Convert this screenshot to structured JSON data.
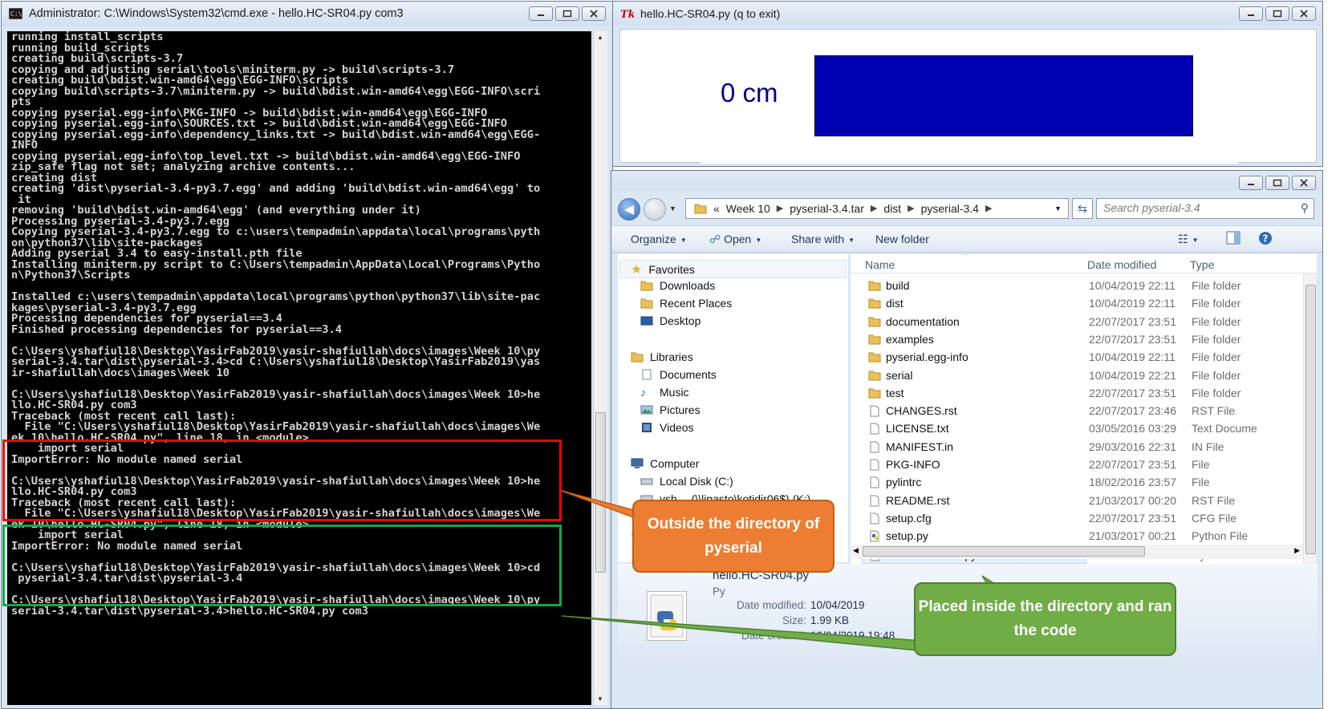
{
  "cmd_window": {
    "title": "Administrator: C:\\Windows\\System32\\cmd.exe - hello.HC-SR04.py  com3",
    "lines": [
      "running install_scripts",
      "running build_scripts",
      "creating build\\scripts-3.7",
      "copying and adjusting serial\\tools\\miniterm.py -> build\\scripts-3.7",
      "creating build\\bdist.win-amd64\\egg\\EGG-INFO\\scripts",
      "copying build\\scripts-3.7\\miniterm.py -> build\\bdist.win-amd64\\egg\\EGG-INFO\\scri",
      "pts",
      "copying pyserial.egg-info\\PKG-INFO -> build\\bdist.win-amd64\\egg\\EGG-INFO",
      "copying pyserial.egg-info\\SOURCES.txt -> build\\bdist.win-amd64\\egg\\EGG-INFO",
      "copying pyserial.egg-info\\dependency_links.txt -> build\\bdist.win-amd64\\egg\\EGG-",
      "INFO",
      "copying pyserial.egg-info\\top_level.txt -> build\\bdist.win-amd64\\egg\\EGG-INFO",
      "zip_safe flag not set; analyzing archive contents...",
      "creating dist",
      "creating 'dist\\pyserial-3.4-py3.7.egg' and adding 'build\\bdist.win-amd64\\egg' to",
      " it",
      "removing 'build\\bdist.win-amd64\\egg' (and everything under it)",
      "Processing pyserial-3.4-py3.7.egg",
      "Copying pyserial-3.4-py3.7.egg to c:\\users\\tempadmin\\appdata\\local\\programs\\pyth",
      "on\\python37\\lib\\site-packages",
      "Adding pyserial 3.4 to easy-install.pth file",
      "Installing miniterm.py script to C:\\Users\\tempadmin\\AppData\\Local\\Programs\\Pytho",
      "n\\Python37\\Scripts",
      "",
      "Installed c:\\users\\tempadmin\\appdata\\local\\programs\\python\\python37\\lib\\site-pac",
      "kages\\pyserial-3.4-py3.7.egg",
      "Processing dependencies for pyserial==3.4",
      "Finished processing dependencies for pyserial==3.4",
      "",
      "C:\\Users\\yshafiul18\\Desktop\\YasirFab2019\\yasir-shafiullah\\docs\\images\\Week 10\\py",
      "serial-3.4.tar\\dist\\pyserial-3.4>cd C:\\Users\\yshafiul18\\Desktop\\YasirFab2019\\yas",
      "ir-shafiullah\\docs\\images\\Week 10",
      "",
      "C:\\Users\\yshafiul18\\Desktop\\YasirFab2019\\yasir-shafiullah\\docs\\images\\Week 10>he",
      "llo.HC-SR04.py com3",
      "Traceback (most recent call last):",
      "  File \"C:\\Users\\yshafiul18\\Desktop\\YasirFab2019\\yasir-shafiullah\\docs\\images\\We",
      "ek 10\\hello.HC-SR04.py\", line 18, in <module>",
      "    import serial",
      "ImportError: No module named serial",
      "",
      "C:\\Users\\yshafiul18\\Desktop\\YasirFab2019\\yasir-shafiullah\\docs\\images\\Week 10>he",
      "llo.HC-SR04.py com3",
      "Traceback (most recent call last):",
      "  File \"C:\\Users\\yshafiul18\\Desktop\\YasirFab2019\\yasir-shafiullah\\docs\\images\\We",
      "ek 10\\hello.HC-SR04.py\", line 18, in <module>",
      "    import serial",
      "ImportError: No module named serial",
      "",
      "C:\\Users\\yshafiul18\\Desktop\\YasirFab2019\\yasir-shafiullah\\docs\\images\\Week 10>cd",
      " pyserial-3.4.tar\\dist\\pyserial-3.4",
      "",
      "C:\\Users\\yshafiul18\\Desktop\\YasirFab2019\\yasir-shafiullah\\docs\\images\\Week 10\\py",
      "serial-3.4.tar\\dist\\pyserial-3.4>hello.HC-SR04.py com3"
    ]
  },
  "tk_window": {
    "title": "hello.HC-SR04.py (q to exit)",
    "distance_label": "0 cm",
    "bar_color": "#0000b3"
  },
  "explorer": {
    "breadcrumb": [
      "«",
      "Week 10",
      "pyserial-3.4.tar",
      "dist",
      "pyserial-3.4"
    ],
    "search_placeholder": "Search pyserial-3.4",
    "toolbar": {
      "organize": "Organize",
      "open": "Open",
      "share_with": "Share with",
      "new_folder": "New folder"
    },
    "nav": {
      "favorites": "Favorites",
      "downloads": "Downloads",
      "recent_places": "Recent Places",
      "desktop": "Desktop",
      "libraries": "Libraries",
      "documents": "Documents",
      "music": "Music",
      "pictures": "Pictures",
      "videos": "Videos",
      "computer": "Computer",
      "local_disk": "Local Disk (C:)",
      "network_drive": "ysh… (\\\\lipasto\\kotidir06$) (K:)",
      "network": "Ne"
    },
    "columns": {
      "name": "Name",
      "date": "Date modified",
      "type": "Type"
    },
    "files": [
      {
        "name": "build",
        "date": "10/04/2019 22:11",
        "type": "File folder",
        "icon": "folder-icon"
      },
      {
        "name": "dist",
        "date": "10/04/2019 22:11",
        "type": "File folder",
        "icon": "folder-icon"
      },
      {
        "name": "documentation",
        "date": "22/07/2017 23:51",
        "type": "File folder",
        "icon": "folder-icon"
      },
      {
        "name": "examples",
        "date": "22/07/2017 23:51",
        "type": "File folder",
        "icon": "folder-icon"
      },
      {
        "name": "pyserial.egg-info",
        "date": "10/04/2019 22:11",
        "type": "File folder",
        "icon": "folder-icon"
      },
      {
        "name": "serial",
        "date": "10/04/2019 22:21",
        "type": "File folder",
        "icon": "folder-icon"
      },
      {
        "name": "test",
        "date": "22/07/2017 23:51",
        "type": "File folder",
        "icon": "folder-icon"
      },
      {
        "name": "CHANGES.rst",
        "date": "22/07/2017 23:46",
        "type": "RST File",
        "icon": "document-icon"
      },
      {
        "name": "LICENSE.txt",
        "date": "03/05/2016 03:29",
        "type": "Text Docume",
        "icon": "document-icon"
      },
      {
        "name": "MANIFEST.in",
        "date": "29/03/2016 22:31",
        "type": "IN File",
        "icon": "document-icon"
      },
      {
        "name": "PKG-INFO",
        "date": "22/07/2017 23:51",
        "type": "File",
        "icon": "document-icon"
      },
      {
        "name": "pylintrc",
        "date": "18/02/2016 23:57",
        "type": "File",
        "icon": "document-icon"
      },
      {
        "name": "README.rst",
        "date": "21/03/2017 00:20",
        "type": "RST File",
        "icon": "document-icon"
      },
      {
        "name": "setup.cfg",
        "date": "22/07/2017 23:51",
        "type": "CFG File",
        "icon": "document-icon"
      },
      {
        "name": "setup.py",
        "date": "21/03/2017 00:21",
        "type": "Python File",
        "icon": "python-file-icon"
      },
      {
        "name": "hello.HC-SR04.py",
        "date": "10/04/2019 19:48",
        "type": "Python File",
        "icon": "python-file-icon"
      }
    ],
    "details": {
      "file_name": "hello.HC-SR04.py",
      "type_partial": "Py",
      "date_modified_label": "Date modified:",
      "date_modified": "10/04/2019",
      "size_label": "Size:",
      "size": "1.99 KB",
      "date_created_label": "Date created:",
      "date_created": "10/04/2019 19:48"
    }
  },
  "annotations": {
    "outside": "Outside the directory of pyserial",
    "inside": "Placed inside the directory and ran the code",
    "outside_color": "#ed7d31",
    "inside_color": "#70ad47"
  }
}
